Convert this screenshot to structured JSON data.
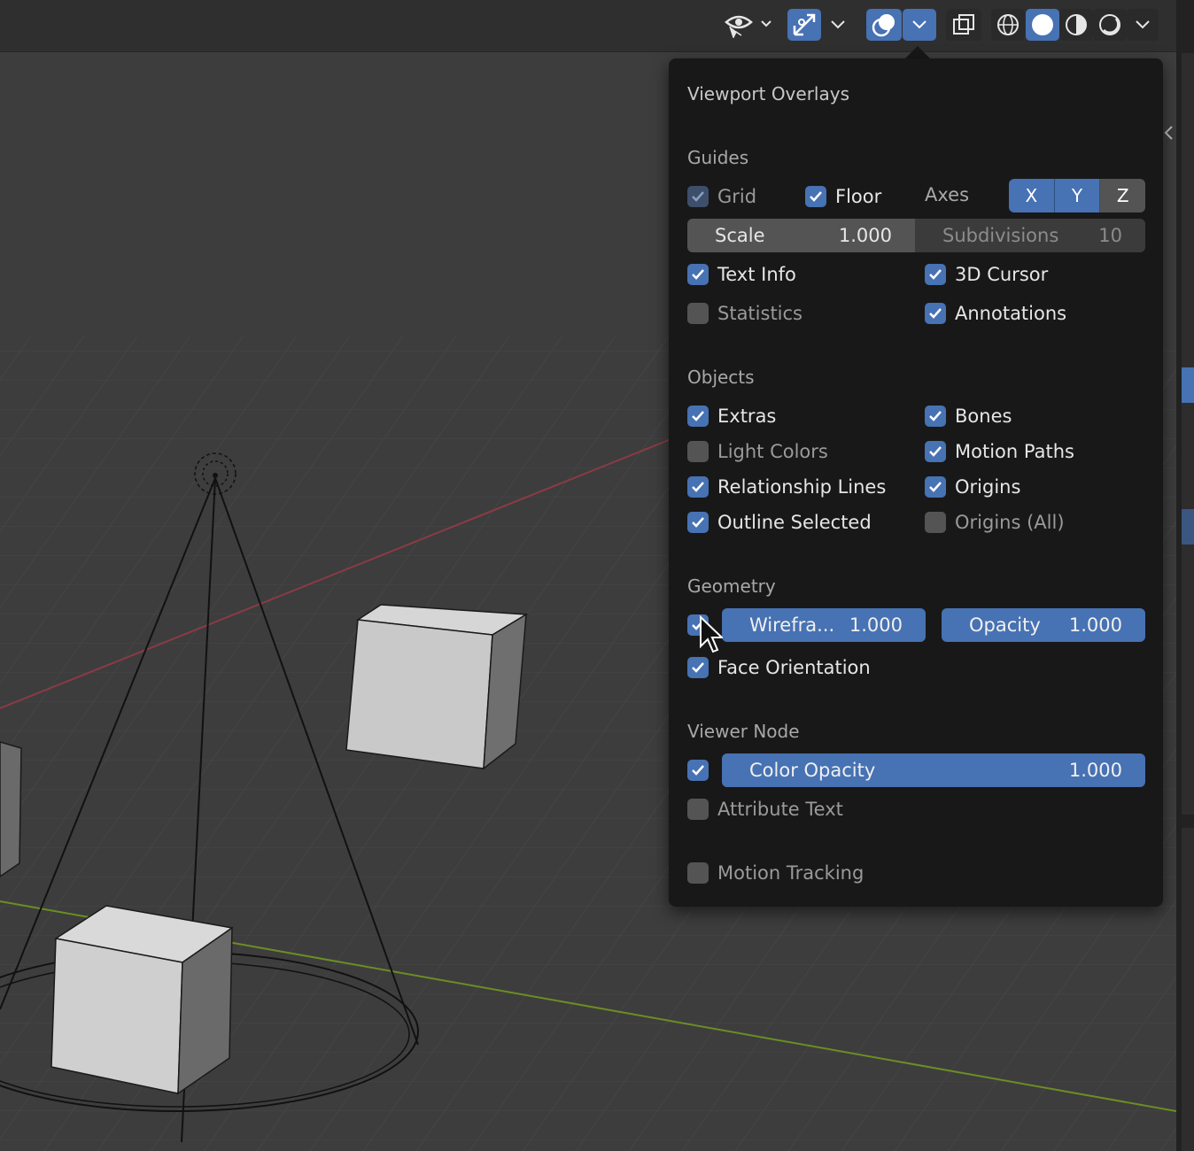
{
  "header": {
    "icons": [
      "visibility-selectability-icon",
      "gizmo-icon",
      "overlays-icon",
      "xray-toggle-icon",
      "wireframe-shading-icon",
      "solid-shading-icon",
      "material-preview-icon",
      "rendered-shading-icon"
    ]
  },
  "overlays_panel": {
    "title": "Viewport Overlays",
    "guides": {
      "section_label": "Guides",
      "grid": {
        "label": "Grid",
        "checked": true
      },
      "floor": {
        "label": "Floor",
        "checked": true
      },
      "axes_label": "Axes",
      "axes": [
        {
          "label": "X",
          "enabled": true
        },
        {
          "label": "Y",
          "enabled": true
        },
        {
          "label": "Z",
          "enabled": false
        }
      ],
      "scale": {
        "label": "Scale",
        "value": "1.000"
      },
      "subdivisions": {
        "label": "Subdivisions",
        "value": "10"
      },
      "text_info": {
        "label": "Text Info",
        "checked": true
      },
      "cursor_3d": {
        "label": "3D Cursor",
        "checked": true
      },
      "statistics": {
        "label": "Statistics",
        "checked": false
      },
      "annotations": {
        "label": "Annotations",
        "checked": true
      }
    },
    "objects": {
      "section_label": "Objects",
      "extras": {
        "label": "Extras",
        "checked": true
      },
      "bones": {
        "label": "Bones",
        "checked": true
      },
      "light_colors": {
        "label": "Light Colors",
        "checked": false
      },
      "motion_paths": {
        "label": "Motion Paths",
        "checked": true
      },
      "relationship_lines": {
        "label": "Relationship Lines",
        "checked": true
      },
      "origins": {
        "label": "Origins",
        "checked": true
      },
      "outline_selected": {
        "label": "Outline Selected",
        "checked": true
      },
      "origins_all": {
        "label": "Origins (All)",
        "checked": false
      }
    },
    "geometry": {
      "section_label": "Geometry",
      "wireframe": {
        "label": "Wirefra...",
        "value": "1.000",
        "checked": true
      },
      "opacity": {
        "label": "Opacity",
        "value": "1.000"
      },
      "face_orientation": {
        "label": "Face Orientation",
        "checked": true
      }
    },
    "viewer_node": {
      "section_label": "Viewer Node",
      "color_opacity": {
        "label": "Color Opacity",
        "value": "1.000",
        "checked": true
      },
      "attribute_text": {
        "label": "Attribute Text",
        "checked": false
      }
    },
    "motion_tracking": {
      "label": "Motion Tracking",
      "checked": false
    }
  },
  "colors": {
    "accent": "#4772b3",
    "panel_bg": "#181818",
    "viewport_bg": "#3d3d3d",
    "x_axis": "#8a3b44",
    "y_axis": "#6b8e23"
  }
}
